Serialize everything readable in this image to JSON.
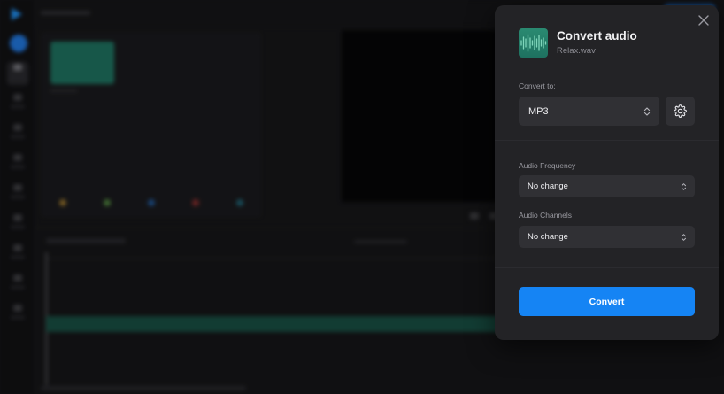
{
  "dialog": {
    "title": "Convert audio",
    "filename": "Relax.wav",
    "convert_to_label": "Convert to:",
    "format_value": "MP3",
    "frequency_label": "Audio Frequency",
    "frequency_value": "No change",
    "channels_label": "Audio Channels",
    "channels_value": "No change",
    "convert_button": "Convert"
  },
  "icons": {
    "close": "close-icon",
    "settings": "gear-icon",
    "file": "audio-waveform-icon",
    "chevron": "chevron-up-down-icon"
  },
  "colors": {
    "accent": "#1584f4",
    "dialog_bg": "#232326",
    "field_bg": "#303034",
    "file_icon": "#2a8a71"
  }
}
